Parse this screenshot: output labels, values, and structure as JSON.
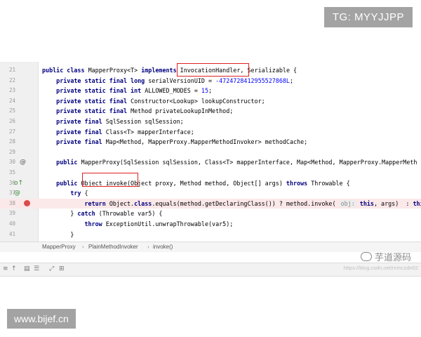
{
  "overlay": {
    "tg_badge": "TG: MYYJJPP",
    "site_badge": "www.bijef.cn",
    "wechat_watermark": "芋道源码",
    "url_watermark": "https://blog.csdn.net/nrmcsdn02"
  },
  "editor": {
    "lines": [
      {
        "num": "21",
        "marker": "",
        "segments": [
          {
            "t": "public class ",
            "c": "kw"
          },
          {
            "t": "MapperProxy<T> ",
            "c": ""
          },
          {
            "t": "implements ",
            "c": "kw"
          },
          {
            "t": "InvocationHandler, ",
            "c": ""
          },
          {
            "t": "Serializable {",
            "c": ""
          }
        ]
      },
      {
        "num": "22",
        "marker": "",
        "segments": [
          {
            "t": "    private static final long ",
            "c": "kw"
          },
          {
            "t": "serialVersionUID = ",
            "c": ""
          },
          {
            "t": "-4724728412955527868L",
            "c": "num"
          },
          {
            "t": ";",
            "c": ""
          }
        ]
      },
      {
        "num": "23",
        "marker": "",
        "segments": [
          {
            "t": "    private static final int ",
            "c": "kw"
          },
          {
            "t": "ALLOWED_MODES = ",
            "c": ""
          },
          {
            "t": "15",
            "c": "num"
          },
          {
            "t": ";",
            "c": ""
          }
        ]
      },
      {
        "num": "24",
        "marker": "",
        "segments": [
          {
            "t": "    private static final ",
            "c": "kw"
          },
          {
            "t": "Constructor<Lookup> lookupConstructor;",
            "c": ""
          }
        ]
      },
      {
        "num": "25",
        "marker": "",
        "segments": [
          {
            "t": "    private static final ",
            "c": "kw"
          },
          {
            "t": "Method privateLookupInMethod;",
            "c": ""
          }
        ]
      },
      {
        "num": "26",
        "marker": "",
        "segments": [
          {
            "t": "    private final ",
            "c": "kw"
          },
          {
            "t": "SqlSession sqlSession;",
            "c": ""
          }
        ]
      },
      {
        "num": "27",
        "marker": "",
        "segments": [
          {
            "t": "    private final ",
            "c": "kw"
          },
          {
            "t": "Class<T> mapperInterface;",
            "c": ""
          }
        ]
      },
      {
        "num": "28",
        "marker": "",
        "segments": [
          {
            "t": "    private final ",
            "c": "kw"
          },
          {
            "t": "Map<Method, MapperProxy.MapperMethodInvoker> methodCache;",
            "c": ""
          }
        ]
      },
      {
        "num": "29",
        "marker": "",
        "segments": []
      },
      {
        "num": "30",
        "marker": "@",
        "segments": [
          {
            "t": "    public ",
            "c": "kw"
          },
          {
            "t": "MapperProxy(SqlSession sqlSession, Class<T> mapperInterface, Map<Method, MapperProxy.MapperMeth",
            "c": ""
          }
        ]
      },
      {
        "num": "35",
        "marker": "",
        "segments": []
      },
      {
        "num": "36",
        "marker": "o↑ @",
        "segments": [
          {
            "t": "    public ",
            "c": "kw"
          },
          {
            "t": "Object invoke(Object proxy, Method method, Object[] args) ",
            "c": ""
          },
          {
            "t": "throws ",
            "c": "kw"
          },
          {
            "t": "Throwable {",
            "c": ""
          }
        ]
      },
      {
        "num": "37",
        "marker": "",
        "segments": [
          {
            "t": "        try ",
            "c": "kw"
          },
          {
            "t": "{",
            "c": ""
          }
        ]
      },
      {
        "num": "38",
        "marker": "breakpoint",
        "segments": [
          {
            "t": "            return ",
            "c": "kw"
          },
          {
            "t": "Object.",
            "c": ""
          },
          {
            "t": "class",
            "c": "kw"
          },
          {
            "t": ".equals(method.getDeclaringClass()) ? method.invoke( ",
            "c": ""
          },
          {
            "t": "obj:",
            "c": "hint"
          },
          {
            "t": " ",
            "c": ""
          },
          {
            "t": "this",
            "c": "kw"
          },
          {
            "t": ", args)  : ",
            "c": ""
          },
          {
            "t": "this",
            "c": "kw"
          }
        ]
      },
      {
        "num": "39",
        "marker": "",
        "segments": [
          {
            "t": "        } ",
            "c": ""
          },
          {
            "t": "catch ",
            "c": "kw"
          },
          {
            "t": "(Throwable var5) {",
            "c": ""
          }
        ]
      },
      {
        "num": "40",
        "marker": "",
        "segments": [
          {
            "t": "            throw ",
            "c": "kw"
          },
          {
            "t": "ExceptionUtil.unwrapThrowable(var5);",
            "c": ""
          }
        ]
      },
      {
        "num": "41",
        "marker": "",
        "segments": [
          {
            "t": "        }",
            "c": ""
          }
        ]
      }
    ]
  },
  "breadcrumb": [
    "MapperProxy",
    "PlainMethodInvoker",
    "invoke()"
  ],
  "tool_strip_icons": [
    "align-icon",
    "up-icon",
    "structure-icon",
    "menu-icon",
    "expand-icon",
    "grid-icon"
  ]
}
